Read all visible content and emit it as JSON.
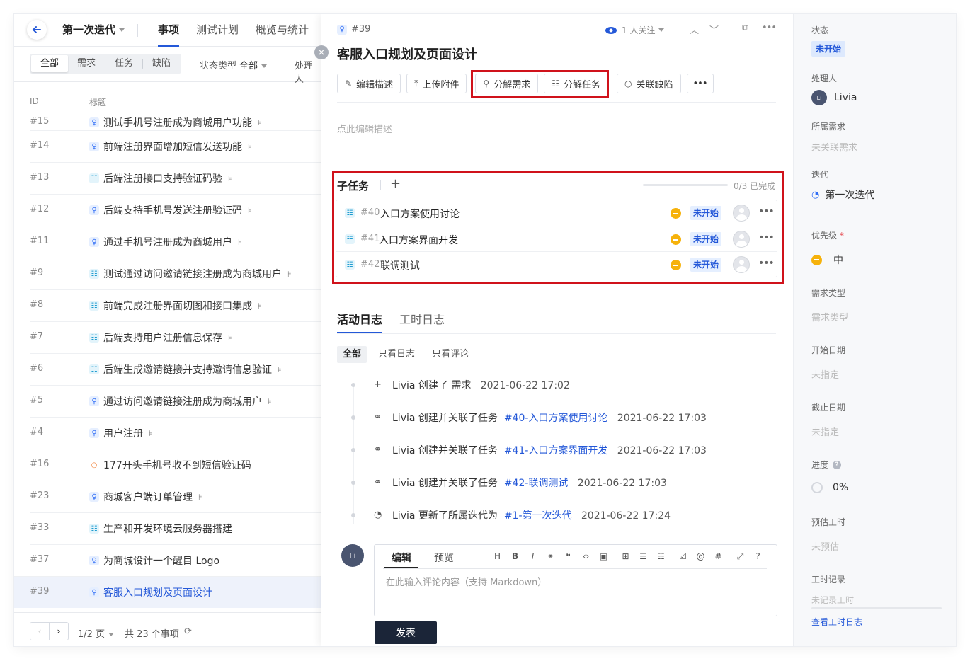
{
  "header": {
    "iteration": "第一次迭代",
    "tabs": [
      "事项",
      "测试计划",
      "概览与统计"
    ]
  },
  "filters": {
    "segments": [
      "全部",
      "需求",
      "任务",
      "缺陷"
    ],
    "status_type_label": "状态类型",
    "status_type_value": "全部",
    "assignee_label": "处理人"
  },
  "table": {
    "col_id": "ID",
    "col_title": "标题",
    "rows": [
      {
        "id": "#15",
        "title": "测试手机号注册成为商城用户功能",
        "type": "req",
        "sub": true
      },
      {
        "id": "#14",
        "title": "前端注册界面增加短信发送功能",
        "type": "req",
        "sub": true
      },
      {
        "id": "#13",
        "title": "后端注册接口支持验证码验",
        "type": "task",
        "sub": true
      },
      {
        "id": "#12",
        "title": "后端支持手机号发送注册验证码",
        "type": "req",
        "sub": true
      },
      {
        "id": "#11",
        "title": "通过手机号注册成为商城用户",
        "type": "req",
        "sub": true
      },
      {
        "id": "#9",
        "title": "测试通过访问邀请链接注册成为商城用户",
        "type": "task",
        "sub": true
      },
      {
        "id": "#8",
        "title": "前端完成注册界面切图和接口集成",
        "type": "task",
        "sub": true
      },
      {
        "id": "#7",
        "title": "后端支持用户注册信息保存",
        "type": "task",
        "sub": true
      },
      {
        "id": "#6",
        "title": "后端生成邀请链接并支持邀请信息验证",
        "type": "task",
        "sub": true
      },
      {
        "id": "#5",
        "title": "通过访问邀请链接注册成为商城用户",
        "type": "req",
        "sub": true
      },
      {
        "id": "#4",
        "title": "用户注册",
        "type": "req",
        "sub": true
      },
      {
        "id": "#16",
        "title": "177开头手机号收不到短信验证码",
        "type": "bug",
        "sub": false
      },
      {
        "id": "#23",
        "title": "商城客户端订单管理",
        "type": "req",
        "sub": true
      },
      {
        "id": "#33",
        "title": "生产和开发环境云服务器搭建",
        "type": "task",
        "sub": false
      },
      {
        "id": "#37",
        "title": "为商城设计一个醒目 Logo",
        "type": "req",
        "sub": false
      },
      {
        "id": "#39",
        "title": "客服入口规划及页面设计",
        "type": "req",
        "sub": false,
        "selected": true
      }
    ]
  },
  "pager": {
    "page": "1/2",
    "page_unit": "页",
    "total": "共 23 个事项"
  },
  "detail": {
    "id": "#39",
    "title": "客服入口规划及页面设计",
    "watch": "1 人关注",
    "toolbar": {
      "edit_desc": "编辑描述",
      "upload": "上传附件",
      "split_req": "分解需求",
      "split_task": "分解任务",
      "link_bug": "关联缺陷"
    },
    "desc_placeholder": "点此编辑描述",
    "subtasks": {
      "heading": "子任务",
      "progress_text": "0/3 已完成",
      "progress": 0,
      "items": [
        {
          "id": "#40",
          "name": "入口方案使用讨论",
          "status": "未开始"
        },
        {
          "id": "#41",
          "name": "入口方案界面开发",
          "status": "未开始"
        },
        {
          "id": "#42",
          "name": "联调测试",
          "status": "未开始"
        }
      ]
    },
    "activity": {
      "tabs": [
        "活动日志",
        "工时日志"
      ],
      "filters": [
        "全部",
        "只看日志",
        "只看评论"
      ],
      "events": [
        {
          "icon": "plus-icon",
          "text": "Livia 创建了 需求",
          "link": "",
          "time": "2021-06-22 17:02"
        },
        {
          "icon": "link-icon",
          "text": "Livia 创建并关联了任务",
          "link": "#40-入口方案使用讨论",
          "time": "2021-06-22 17:03"
        },
        {
          "icon": "link-icon",
          "text": "Livia 创建并关联了任务",
          "link": "#41-入口方案界面开发",
          "time": "2021-06-22 17:03"
        },
        {
          "icon": "link-icon",
          "text": "Livia 创建并关联了任务",
          "link": "#42-联调测试",
          "time": "2021-06-22 17:03"
        },
        {
          "icon": "iteration-icon",
          "text": "Livia 更新了所属迭代为",
          "link": "#1-第一次迭代",
          "time": "2021-06-22 17:24"
        }
      ]
    },
    "comment": {
      "avatar": "Li",
      "tab_edit": "编辑",
      "tab_preview": "预览",
      "placeholder": "在此输入评论内容（支持 Markdown）",
      "post": "发表"
    }
  },
  "sidebar": {
    "status_label": "状态",
    "status_value": "未开始",
    "assignee_label": "处理人",
    "assignee_avatar": "Li",
    "assignee_name": "Livia",
    "req_label": "所属需求",
    "req_value": "未关联需求",
    "iter_label": "迭代",
    "iter_value": "第一次迭代",
    "priority_label": "优先级",
    "priority_required": "*",
    "priority_value": "中",
    "req_type_label": "需求类型",
    "req_type_value": "需求类型",
    "start_label": "开始日期",
    "start_value": "未指定",
    "due_label": "截止日期",
    "due_value": "未指定",
    "progress_label": "进度",
    "progress_help": "?",
    "progress_value": "0%",
    "estimate_label": "预估工时",
    "estimate_value": "未预估",
    "worklog_label": "工时记录",
    "worklog_value": "未记录工时",
    "worklog_link": "查看工时日志"
  },
  "colors": {
    "accent": "#2458d8",
    "highlight_box": "#d0121b",
    "priority_medium": "#f6b20b"
  }
}
